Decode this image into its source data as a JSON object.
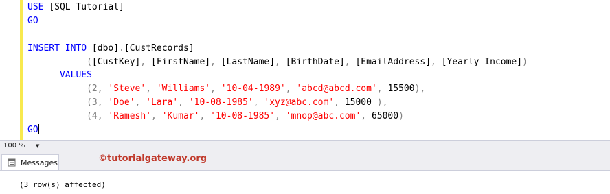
{
  "editor": {
    "lines": [
      [
        {
          "t": "USE",
          "c": "kw"
        },
        {
          "t": " [SQL Tutorial]"
        }
      ],
      [
        {
          "t": "GO",
          "c": "kw"
        }
      ],
      [],
      [
        {
          "t": "INSERT",
          "c": "kw"
        },
        {
          "t": " "
        },
        {
          "t": "INTO",
          "c": "kw"
        },
        {
          "t": " [dbo]"
        },
        {
          "t": ".",
          "c": "op"
        },
        {
          "t": "[CustRecords]"
        }
      ],
      [
        {
          "t": "           "
        },
        {
          "t": "(",
          "c": "op"
        },
        {
          "t": "[CustKey]"
        },
        {
          "t": ",",
          "c": "op"
        },
        {
          "t": " [FirstName]"
        },
        {
          "t": ",",
          "c": "op"
        },
        {
          "t": " [LastName]"
        },
        {
          "t": ",",
          "c": "op"
        },
        {
          "t": " [BirthDate]"
        },
        {
          "t": ",",
          "c": "op"
        },
        {
          "t": " [EmailAddress]"
        },
        {
          "t": ",",
          "c": "op"
        },
        {
          "t": " [Yearly Income]"
        },
        {
          "t": ")",
          "c": "op"
        }
      ],
      [
        {
          "t": "      "
        },
        {
          "t": "VALUES",
          "c": "kw"
        }
      ],
      [
        {
          "t": "           "
        },
        {
          "t": "(2",
          "c": "op"
        },
        {
          "t": ", ",
          "c": "op"
        },
        {
          "t": "'Steve'",
          "c": "str"
        },
        {
          "t": ", ",
          "c": "op"
        },
        {
          "t": "'Williams'",
          "c": "str"
        },
        {
          "t": ", ",
          "c": "op"
        },
        {
          "t": "'10-04-1989'",
          "c": "str"
        },
        {
          "t": ", ",
          "c": "op"
        },
        {
          "t": "'abcd@abcd.com'",
          "c": "str"
        },
        {
          "t": ", ",
          "c": "op"
        },
        {
          "t": "15500"
        },
        {
          "t": "),",
          "c": "op"
        }
      ],
      [
        {
          "t": "           "
        },
        {
          "t": "(3",
          "c": "op"
        },
        {
          "t": ", ",
          "c": "op"
        },
        {
          "t": "'Doe'",
          "c": "str"
        },
        {
          "t": ", ",
          "c": "op"
        },
        {
          "t": "'Lara'",
          "c": "str"
        },
        {
          "t": ", ",
          "c": "op"
        },
        {
          "t": "'10-08-1985'",
          "c": "str"
        },
        {
          "t": ", ",
          "c": "op"
        },
        {
          "t": "'xyz@abc.com'",
          "c": "str"
        },
        {
          "t": ", ",
          "c": "op"
        },
        {
          "t": "15000"
        },
        {
          "t": " ),",
          "c": "op"
        }
      ],
      [
        {
          "t": "           "
        },
        {
          "t": "(4",
          "c": "op"
        },
        {
          "t": ", ",
          "c": "op"
        },
        {
          "t": "'Ramesh'",
          "c": "str"
        },
        {
          "t": ", ",
          "c": "op"
        },
        {
          "t": "'Kumar'",
          "c": "str"
        },
        {
          "t": ", ",
          "c": "op"
        },
        {
          "t": "'10-08-1985'",
          "c": "str"
        },
        {
          "t": ", ",
          "c": "op"
        },
        {
          "t": "'mnop@abc.com'",
          "c": "str"
        },
        {
          "t": ", ",
          "c": "op"
        },
        {
          "t": "65000"
        },
        {
          "t": ")",
          "c": "op"
        }
      ],
      [
        {
          "t": "GO",
          "c": "kw"
        },
        {
          "caret": true
        }
      ]
    ]
  },
  "zoom": {
    "value": "100 %",
    "icon": "chevron-down-icon"
  },
  "results": {
    "tab_label": "Messages",
    "tab_icon": "messages-icon",
    "message": "(3 row(s) affected)"
  },
  "watermark": "©tutorialgateway.org",
  "colors": {
    "keyword": "#0000ff",
    "string": "#ff0000",
    "operator": "#808080",
    "change_bar": "#f8e94e",
    "watermark": "#c0392b"
  }
}
